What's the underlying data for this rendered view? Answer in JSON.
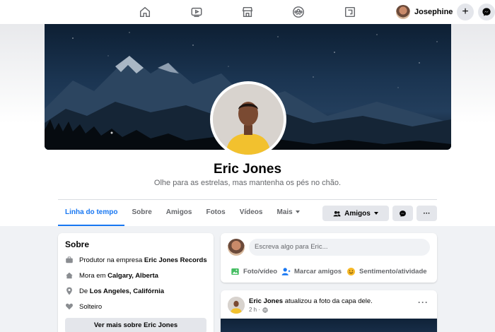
{
  "nav": {
    "icons": [
      "home-icon",
      "watch-icon",
      "marketplace-icon",
      "groups-icon",
      "gaming-icon"
    ],
    "user_name": "Josephine",
    "create_label": "+",
    "messenger_icon": "messenger-icon"
  },
  "profile": {
    "name": "Eric Jones",
    "bio": "Olhe para as estrelas, mas mantenha os pés no chão."
  },
  "tabs": {
    "timeline": "Linha do tempo",
    "about": "Sobre",
    "friends": "Amigos",
    "photos": "Fotos",
    "videos": "Vídeos",
    "more": "Mais"
  },
  "actions": {
    "friends_label": "Amigos",
    "more_dots": "···"
  },
  "about": {
    "title": "Sobre",
    "work_prefix": "Produtor na empresa ",
    "work_company": "Eric Jones Records",
    "lives_prefix": "Mora em ",
    "lives_city": "Calgary, Alberta",
    "from_prefix": "De ",
    "from_city": "Los Angeles, Califórnia",
    "relationship": "Solteiro",
    "see_more": "Ver mais sobre Eric Jones"
  },
  "composer": {
    "placeholder": "Escreva algo para Eric...",
    "photo_video": "Foto/vídeo",
    "tag_friends": "Marcar amigos",
    "feeling": "Sentimento/atividade"
  },
  "post": {
    "author": "Eric Jones",
    "text": " atualizou a foto da capa dele.",
    "time": "2 h ·",
    "dots": "···"
  },
  "colors": {
    "accent": "#1877f2",
    "photo_green": "#45bd62",
    "tag_blue": "#1877f2",
    "feeling_yellow": "#f7b928"
  }
}
